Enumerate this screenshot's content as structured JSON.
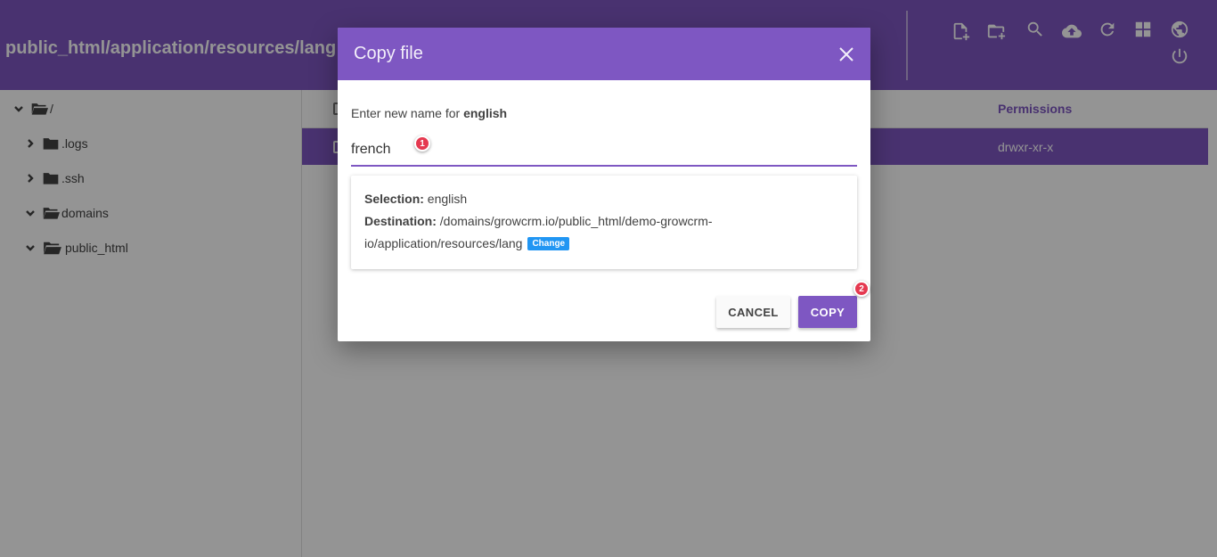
{
  "header": {
    "path_title": "public_html/application/resources/lang"
  },
  "toolbar": {
    "icons": [
      "new-file-icon",
      "new-folder-icon",
      "search-icon",
      "upload-icon",
      "refresh-icon",
      "grid-view-icon",
      "globe-icon",
      "power-icon"
    ]
  },
  "sidebar": {
    "items": [
      {
        "label": "/",
        "expanded": true
      },
      {
        "label": ".logs",
        "expanded": false
      },
      {
        "label": ".ssh",
        "expanded": false
      },
      {
        "label": "domains",
        "expanded": true
      },
      {
        "label": "public_html",
        "expanded": true
      }
    ]
  },
  "table": {
    "columns": {
      "permissions": "Permissions"
    },
    "selected_row": {
      "permissions": "drwxr-xr-x"
    }
  },
  "dialog": {
    "title": "Copy file",
    "prompt_prefix": "Enter new name for",
    "prompt_target": "english",
    "input_value": "french",
    "selection_label": "Selection:",
    "selection_value": "english",
    "destination_label": "Destination:",
    "destination_line1": "/domains/growcrm.io/public_html/demo-growcrm-",
    "destination_line2": "io/application/resources/lang",
    "change_label": "Change",
    "cancel_label": "CANCEL",
    "copy_label": "COPY"
  },
  "annotations": {
    "step1": "1",
    "step2": "2"
  },
  "colors": {
    "primary": "#7e57c2",
    "change_badge": "#2196f3",
    "step_badge": "#e53950"
  }
}
